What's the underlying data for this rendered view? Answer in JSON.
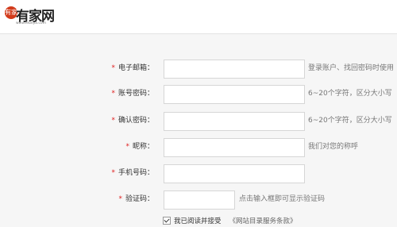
{
  "logo": {
    "seal": "有家",
    "name": "有家网",
    "url": "www.lebejia.com"
  },
  "form": {
    "email": {
      "label": "电子邮箱：",
      "hint": "登录账户、找回密码时使用",
      "value": ""
    },
    "password": {
      "label": "账号密码：",
      "hint": "6~20个字符，区分大小写",
      "value": ""
    },
    "confirm": {
      "label": "确认密码：",
      "hint": "6~20个字符，区分大小写",
      "value": ""
    },
    "nickname": {
      "label": "昵称：",
      "hint": "我们对您的称呼",
      "value": ""
    },
    "phone": {
      "label": "手机号码：",
      "value": ""
    },
    "captcha": {
      "label": "验证码：",
      "hint": "点击输入框即可显示验证码",
      "value": ""
    }
  },
  "required_mark": "*",
  "agree": {
    "checked": true,
    "text": "我已阅读并接受",
    "terms": "《网站目录服务条款》"
  }
}
